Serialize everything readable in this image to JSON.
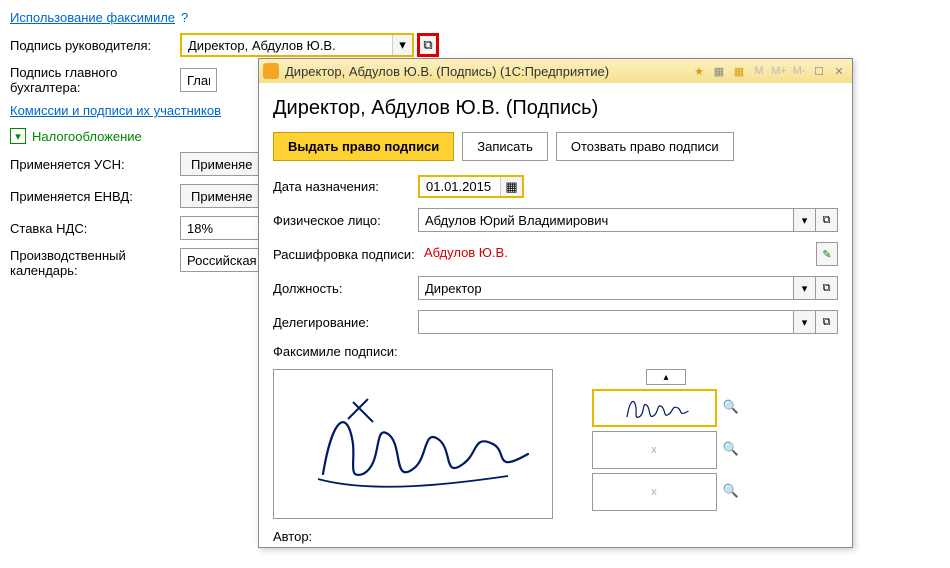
{
  "header": {
    "faksimile_link": "Использование факсимиле",
    "help": "?"
  },
  "main": {
    "sign_head_label": "Подпись руководителя:",
    "sign_head_value": "Директор, Абдулов Ю.В.",
    "sign_acc_label": "Подпись главного бухгалтера:",
    "sign_acc_value": "Глав",
    "commissions_link": "Комиссии и подписи их участников"
  },
  "tax": {
    "header": "Налогообложение",
    "usn_label": "Применяется УСН:",
    "usn_btn": "Применяе",
    "envd_label": "Применяется ЕНВД:",
    "envd_btn": "Применяе",
    "nds_label": "Ставка НДС:",
    "nds_value": "18%",
    "cal_label": "Производственный календарь:",
    "cal_value": "Российская Ф"
  },
  "dialog": {
    "titlebar": "Директор, Абдулов Ю.В. (Подпись)   (1С:Предприятие)",
    "title": "Директор, Абдулов Ю.В. (Подпись)",
    "btn_issue": "Выдать право подписи",
    "btn_write": "Записать",
    "btn_revoke": "Отозвать право подписи",
    "date_label": "Дата назначения:",
    "date_value": "01.01.2015",
    "person_label": "Физическое лицо:",
    "person_value": "Абдулов Юрий Владимирович",
    "decode_label": "Расшифровка подписи:",
    "decode_value": "Абдулов Ю.В.",
    "position_label": "Должность:",
    "position_value": "Директор",
    "delegation_label": "Делегирование:",
    "delegation_value": "",
    "fax_label": "Факсимиле подписи:",
    "author_label": "Автор:",
    "thumb_x": "x",
    "toolbar": {
      "m1": "M",
      "m2": "M+",
      "m3": "M-"
    }
  },
  "icons": {
    "chevron": "▾",
    "open": "⧉",
    "up": "▴",
    "pencil": "✎",
    "calendar": "📅",
    "close": "✕",
    "max": "☐",
    "star": "★",
    "mag": "🔍"
  }
}
